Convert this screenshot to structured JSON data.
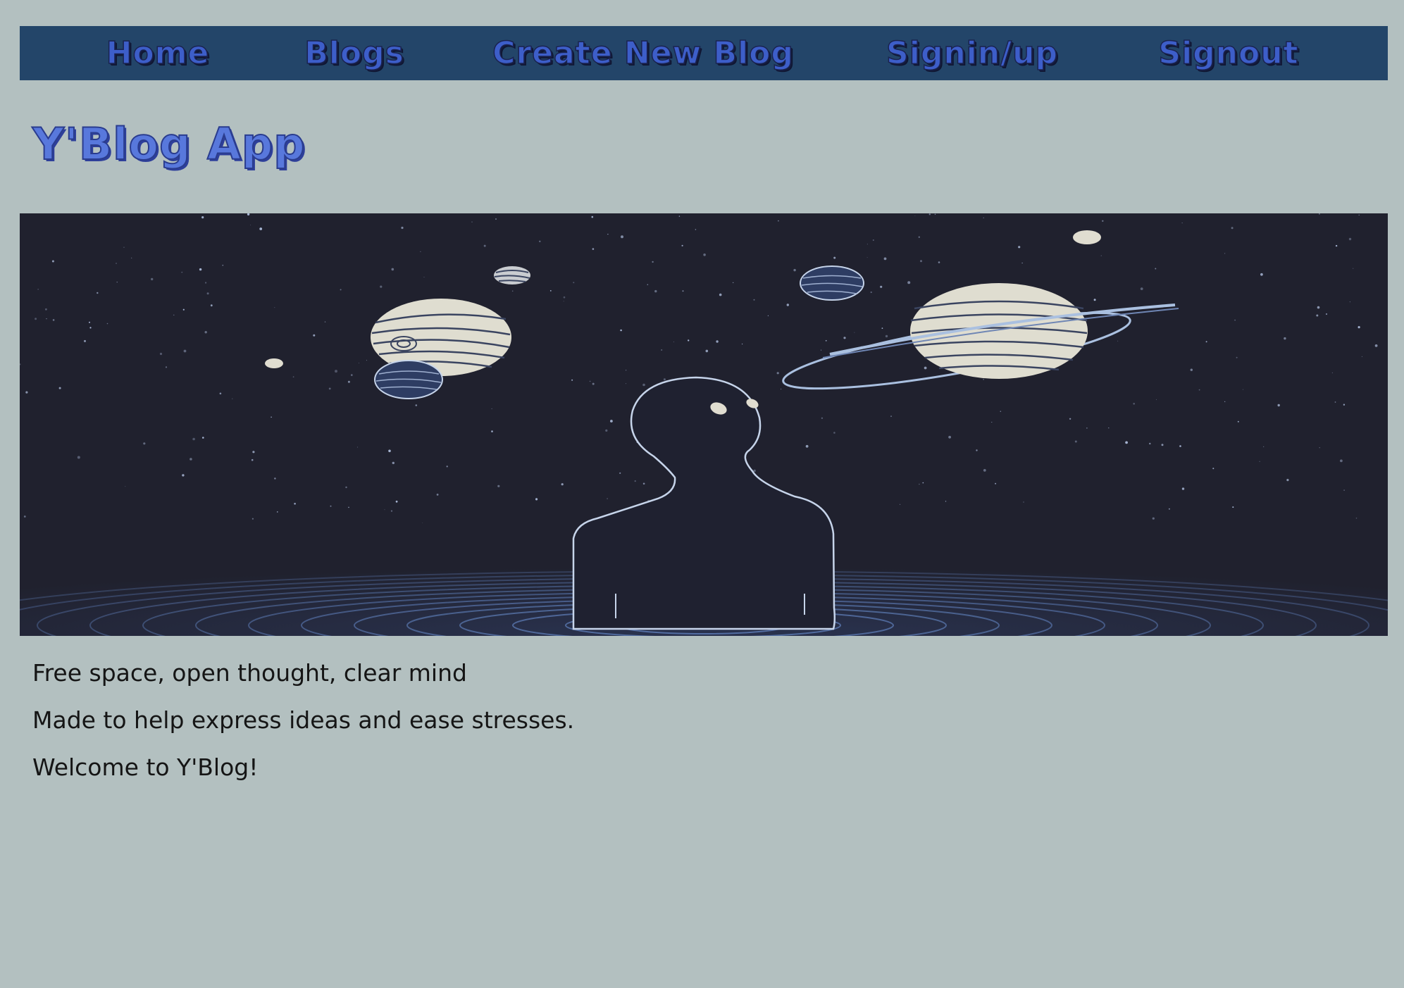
{
  "nav": {
    "items": [
      {
        "label": "Home"
      },
      {
        "label": "Blogs"
      },
      {
        "label": "Create New Blog"
      },
      {
        "label": "Signin/up"
      },
      {
        "label": "Signout"
      }
    ]
  },
  "header": {
    "title": "Y'Blog App"
  },
  "hero": {
    "image_name": "space-illustration-person-in-water-looking-at-planets"
  },
  "content": {
    "lines": [
      "Free space, open thought, clear mind",
      "Made to help express ideas and ease stresses.",
      "Welcome to Y'Blog!"
    ]
  },
  "colors": {
    "background": "#b3c0c0",
    "navbar": "#234569",
    "nav_text": "#3d5ec9",
    "title_text": "#5878dc",
    "hero_bg": "#20212e",
    "body_text": "#151515"
  }
}
